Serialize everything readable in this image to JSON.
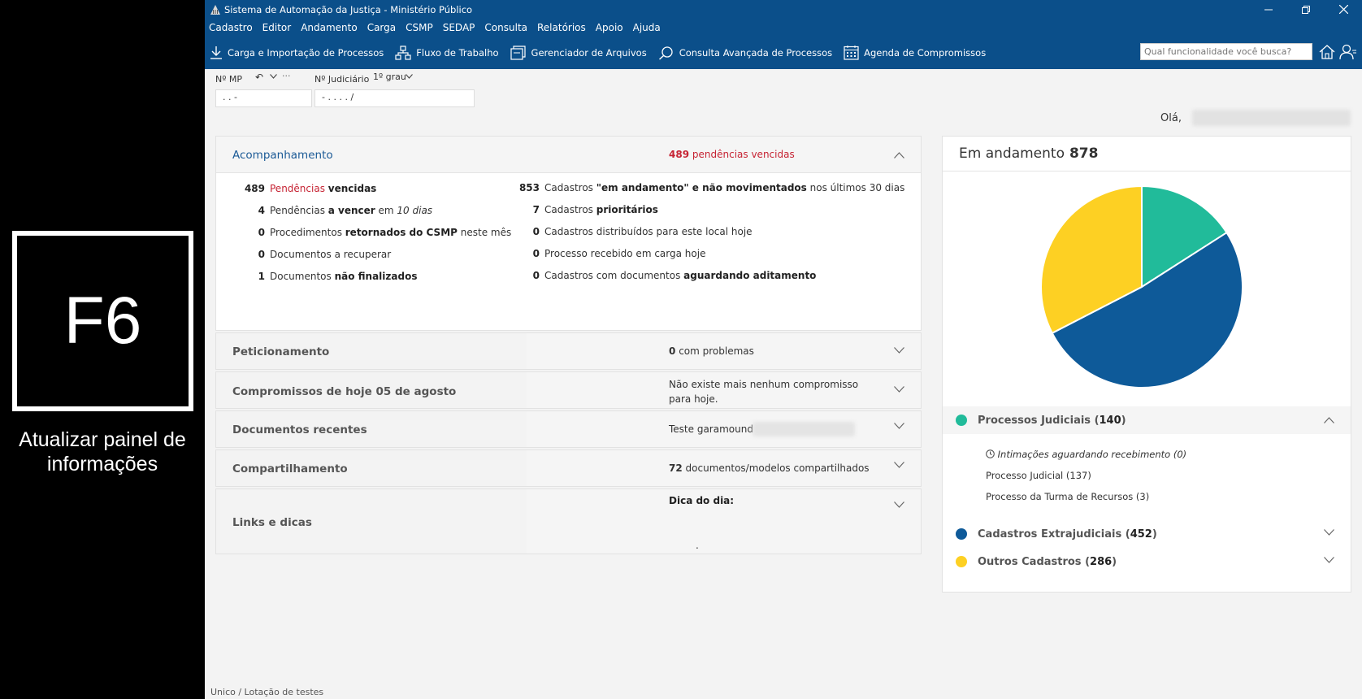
{
  "overlay": {
    "key": "F6",
    "caption": "Atualizar painel de informações"
  },
  "window": {
    "title": "Sistema de Automação da Justiça - Ministério Público"
  },
  "menu": [
    "Cadastro",
    "Editor",
    "Andamento",
    "Carga",
    "CSMP",
    "SEDAP",
    "Consulta",
    "Relatórios",
    "Apoio",
    "Ajuda"
  ],
  "toolbar": {
    "items": [
      {
        "label": "Carga e Importação de Processos",
        "icon": "download-icon"
      },
      {
        "label": "Fluxo de Trabalho",
        "icon": "workflow-icon"
      },
      {
        "label": "Gerenciador de Arquivos",
        "icon": "file-manager-icon"
      },
      {
        "label": "Consulta Avançada de Processos",
        "icon": "advanced-search-icon"
      },
      {
        "label": "Agenda de Compromissos",
        "icon": "calendar-icon"
      }
    ],
    "search_placeholder": "Qual funcionalidade você busca?"
  },
  "fields": {
    "mp_label": "Nº MP",
    "mp_value": ".   .   -",
    "judicial_label": "Nº Judiciário",
    "judicial_degree": "1º grau",
    "judicial_value": "-  .  .  .  .   /"
  },
  "greeting": "Olá,",
  "acompanhamento": {
    "title": "Acompanhamento",
    "overdue_count": "489",
    "overdue_label": "pendências vencidas",
    "left": [
      {
        "num": "489",
        "parts": [
          [
            "Pendências ",
            "red"
          ],
          [
            "vencidas",
            "redb"
          ]
        ],
        "num_red": true
      },
      {
        "num": "4",
        "parts": [
          [
            "Pendências ",
            ""
          ],
          [
            "a vencer",
            "b"
          ],
          [
            " em ",
            ""
          ],
          [
            "10 dias",
            "i"
          ]
        ]
      },
      {
        "num": "0",
        "parts": [
          [
            "Procedimentos ",
            ""
          ],
          [
            "retornados do CSMP",
            "b"
          ],
          [
            " neste mês",
            ""
          ]
        ]
      },
      {
        "num": "0",
        "parts": [
          [
            "Documentos a recuperar",
            ""
          ]
        ]
      },
      {
        "num": "1",
        "parts": [
          [
            "Documentos ",
            ""
          ],
          [
            "não finalizados",
            "b"
          ]
        ]
      }
    ],
    "right": [
      {
        "num": "853",
        "parts": [
          [
            "Cadastros ",
            ""
          ],
          [
            "\"em andamento\" e não movimentados",
            "b"
          ],
          [
            " nos últimos 30 dias",
            ""
          ]
        ]
      },
      {
        "num": "7",
        "parts": [
          [
            "Cadastros ",
            ""
          ],
          [
            "prioritários",
            "b"
          ]
        ]
      },
      {
        "num": "0",
        "parts": [
          [
            "Cadastros distribuídos para este local hoje",
            ""
          ]
        ]
      },
      {
        "num": "0",
        "parts": [
          [
            "Processo recebido em carga hoje",
            ""
          ]
        ]
      },
      {
        "num": "0",
        "parts": [
          [
            "Cadastros com documentos ",
            ""
          ],
          [
            "aguardando aditamento",
            "b"
          ]
        ]
      }
    ]
  },
  "panels": {
    "peticionamento": {
      "title": "Peticionamento",
      "count": "0",
      "side": "com problemas"
    },
    "compromissos": {
      "title": "Compromissos de hoje 05 de agosto",
      "side": "Não existe mais nenhum compromisso para hoje."
    },
    "documentos": {
      "title": "Documentos recentes",
      "side": "Teste garamound"
    },
    "compartilhamento": {
      "title": "Compartilhamento",
      "count": "72",
      "side": "documentos/modelos compartilhados"
    },
    "links": {
      "title": "Links e dicas",
      "side": "Dica do dia:",
      "dot": "."
    }
  },
  "chart_data": {
    "type": "pie",
    "title": "Em andamento",
    "total": "878",
    "series": [
      {
        "name": "Processos Judiciais",
        "value": 140,
        "color": "#21bb9a"
      },
      {
        "name": "Cadastros Extrajudiciais",
        "value": 452,
        "color": "#0e5a99"
      },
      {
        "name": "Outros Cadastros",
        "value": 286,
        "color": "#fdd023"
      }
    ]
  },
  "legend": {
    "judiciais": {
      "label": "Processos Judiciais",
      "count": "140"
    },
    "sub": [
      "Intimações aguardando recebimento (0)",
      "Processo Judicial (137)",
      "Processo da Turma de Recursos (3)"
    ],
    "extrajudiciais": {
      "label": "Cadastros Extrajudiciais",
      "count": "452"
    },
    "outros": {
      "label": "Outros Cadastros",
      "count": "286"
    }
  },
  "footer": "Unico / Lotação de testes"
}
